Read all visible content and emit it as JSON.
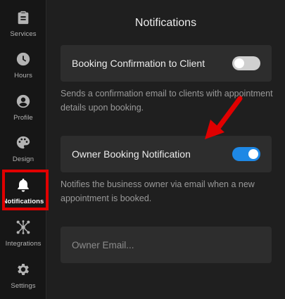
{
  "sidebar": {
    "items": [
      {
        "label": "Services",
        "icon": "clipboard-icon"
      },
      {
        "label": "Hours",
        "icon": "clock-icon"
      },
      {
        "label": "Profile",
        "icon": "user-circle-icon"
      },
      {
        "label": "Design",
        "icon": "palette-icon"
      },
      {
        "label": "Notifications",
        "icon": "bell-icon",
        "active": true
      },
      {
        "label": "Integrations",
        "icon": "network-icon"
      },
      {
        "label": "Settings",
        "icon": "gear-icon"
      }
    ]
  },
  "main": {
    "title": "Notifications",
    "booking_confirmation": {
      "label": "Booking Confirmation to Client",
      "enabled": false,
      "description": "Sends a confirmation email to clients with appointment details upon booking."
    },
    "owner_notification": {
      "label": "Owner Booking Notification",
      "enabled": true,
      "description": "Notifies the business owner via email when a new appointment is booked."
    },
    "owner_email": {
      "value": "",
      "placeholder": "Owner Email..."
    }
  },
  "colors": {
    "accent": "#1e88e5",
    "highlight": "#e00000",
    "background": "#1f1f1f",
    "card": "#2d2d2d"
  }
}
